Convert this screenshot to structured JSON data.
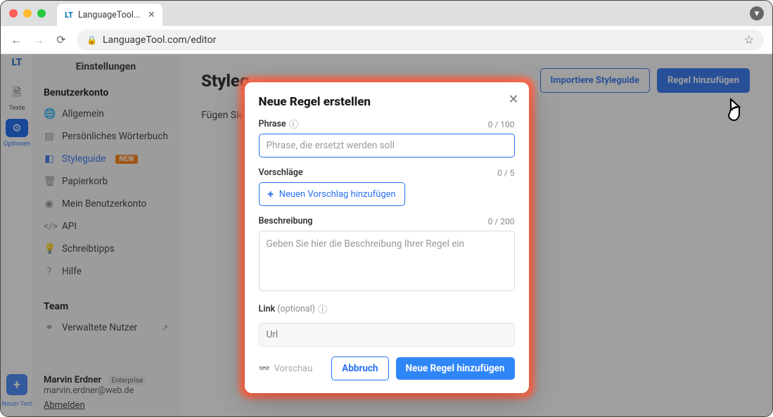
{
  "browser": {
    "tab_title": "LanguageTool...",
    "url": "LanguageTool.com/editor"
  },
  "leftrail": {
    "texte": "Texte",
    "optionen": "Optionen",
    "neuer_text": "Neuer Text"
  },
  "settings": {
    "title": "Einstellungen",
    "section_account": "Benutzerkonto",
    "items": {
      "allgemein": "Allgemein",
      "woerterbuch": "Persönliches Wörterbuch",
      "styleguide": "Styleguide",
      "styleguide_badge": "NEW",
      "papierkorb": "Papierkorb",
      "benutzerkonto": "Mein Benutzerkonto",
      "api": "API",
      "schreibtipps": "Schreibtipps",
      "hilfe": "Hilfe"
    },
    "section_team": "Team",
    "verwaltete_nutzer": "Verwaltete Nutzer"
  },
  "user": {
    "name": "Marvin Erdner",
    "plan": "Enterprise",
    "email": "marvin.erdner@web.de",
    "logout": "Abmelden"
  },
  "main": {
    "title": "Styleg",
    "subline": "Fügen Sie F",
    "import_btn": "Importiere Styleguide",
    "add_btn": "Regel hinzufügen"
  },
  "modal": {
    "title": "Neue Regel erstellen",
    "phrase_label": "Phrase",
    "phrase_counter": "0 / 100",
    "phrase_placeholder": "Phrase, die ersetzt werden soll",
    "vorschlaege_label": "Vorschläge",
    "vorschlaege_counter": "0 / 5",
    "add_suggestion": "Neuen Vorschlag hinzufügen",
    "beschreibung_label": "Beschreibung",
    "beschreibung_counter": "0 / 200",
    "beschreibung_placeholder": "Geben Sie hier die Beschreibung Ihrer Regel ein",
    "link_label": "Link",
    "link_optional": " (optional)",
    "link_placeholder": "Url",
    "preview": "Vorschau",
    "cancel": "Abbruch",
    "create": "Neue Regel hinzufügen"
  }
}
